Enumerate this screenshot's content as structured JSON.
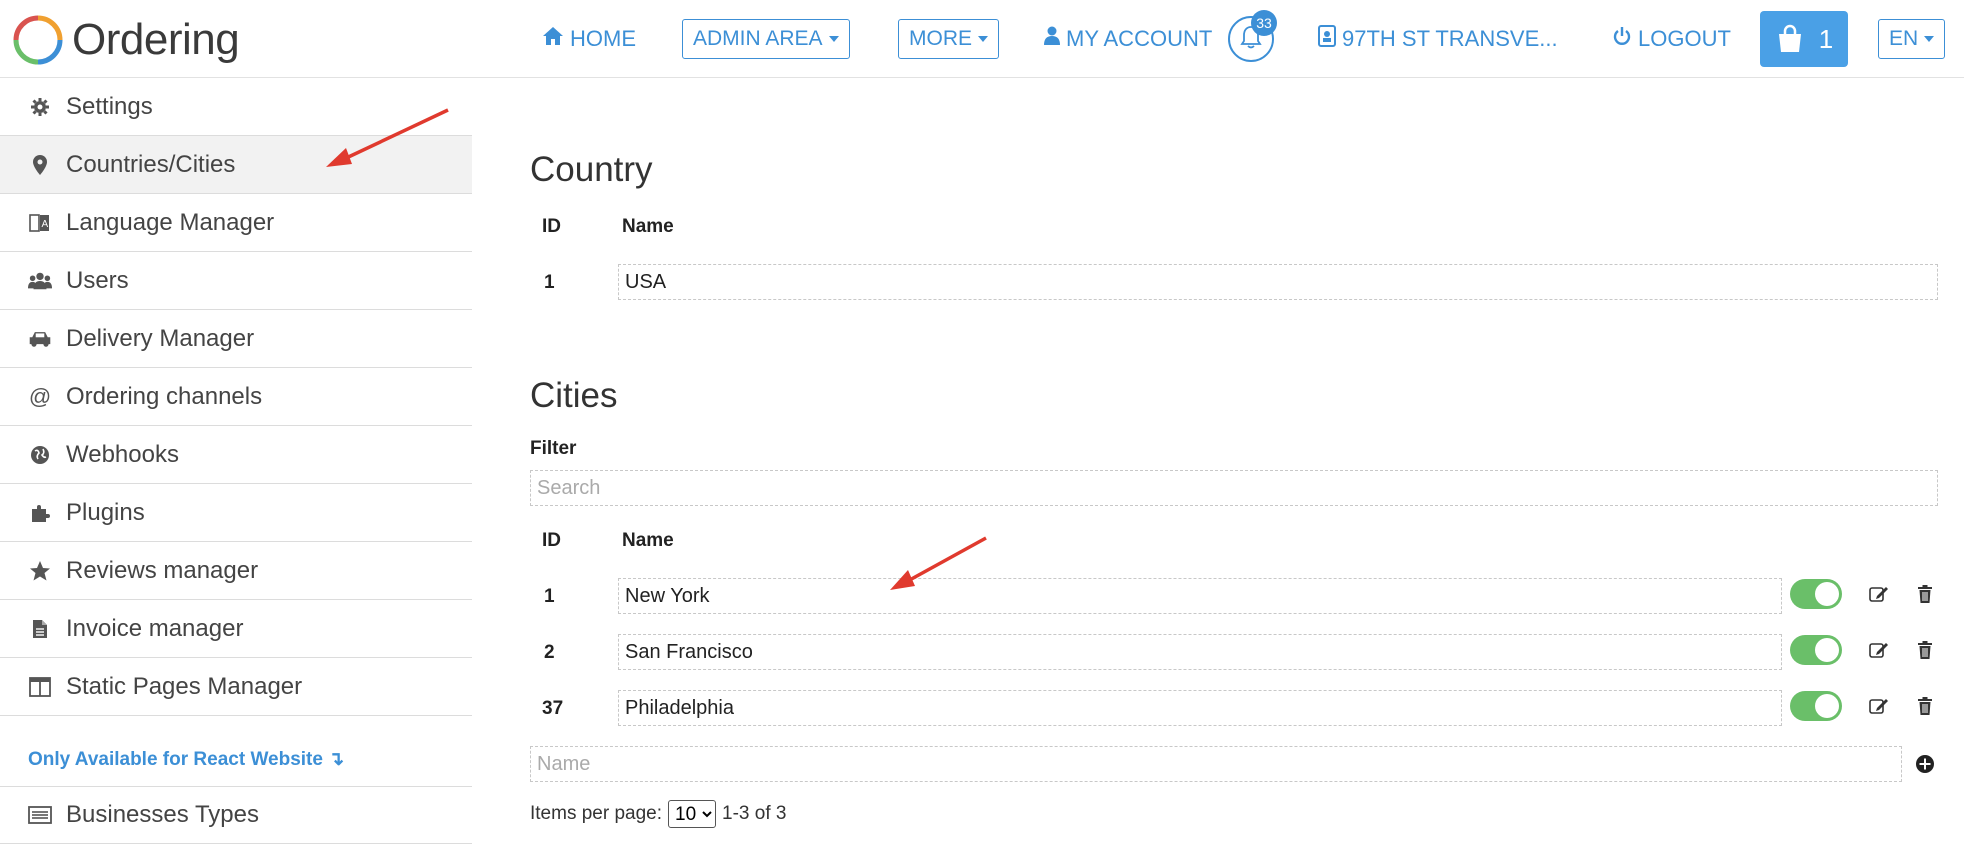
{
  "header": {
    "logo_text": "Ordering",
    "nav": {
      "home": "HOME",
      "admin_area": "ADMIN AREA",
      "more": "MORE",
      "my_account": "MY ACCOUNT",
      "notifications_count": "33",
      "store": "97TH ST TRANSVE...",
      "logout": "LOGOUT",
      "cart_count": "1",
      "language": "EN"
    },
    "accent_color": "#3c8fd6"
  },
  "sidebar": {
    "items": [
      {
        "label": "Settings",
        "icon": "gear-icon"
      },
      {
        "label": "Countries/Cities",
        "icon": "map-marker-icon",
        "active": true
      },
      {
        "label": "Language Manager",
        "icon": "language-icon"
      },
      {
        "label": "Users",
        "icon": "users-icon"
      },
      {
        "label": "Delivery Manager",
        "icon": "car-icon"
      },
      {
        "label": "Ordering channels",
        "icon": "at-icon"
      },
      {
        "label": "Webhooks",
        "icon": "globe-icon"
      },
      {
        "label": "Plugins",
        "icon": "puzzle-icon"
      },
      {
        "label": "Reviews manager",
        "icon": "star-icon"
      },
      {
        "label": "Invoice manager",
        "icon": "file-icon"
      },
      {
        "label": "Static Pages Manager",
        "icon": "columns-icon"
      }
    ],
    "react_note": "Only Available for React Website ↴",
    "extra_items": [
      {
        "label": "Businesses Types",
        "icon": "list-icon"
      }
    ]
  },
  "country": {
    "title": "Country",
    "headers": {
      "id": "ID",
      "name": "Name"
    },
    "rows": [
      {
        "id": "1",
        "name": "USA"
      }
    ]
  },
  "cities": {
    "title": "Cities",
    "filter_label": "Filter",
    "search_placeholder": "Search",
    "headers": {
      "id": "ID",
      "name": "Name"
    },
    "rows": [
      {
        "id": "1",
        "name": "New York",
        "enabled": true
      },
      {
        "id": "2",
        "name": "San Francisco",
        "enabled": true
      },
      {
        "id": "37",
        "name": "Philadelphia",
        "enabled": true
      }
    ],
    "new_name_placeholder": "Name",
    "pagination": {
      "items_per_page_label": "Items per page:",
      "items_per_page": "10",
      "range": "1-3 of 3"
    }
  },
  "colors": {
    "toggle_on": "#6abf69",
    "annotation_arrow": "#e03a2e"
  }
}
